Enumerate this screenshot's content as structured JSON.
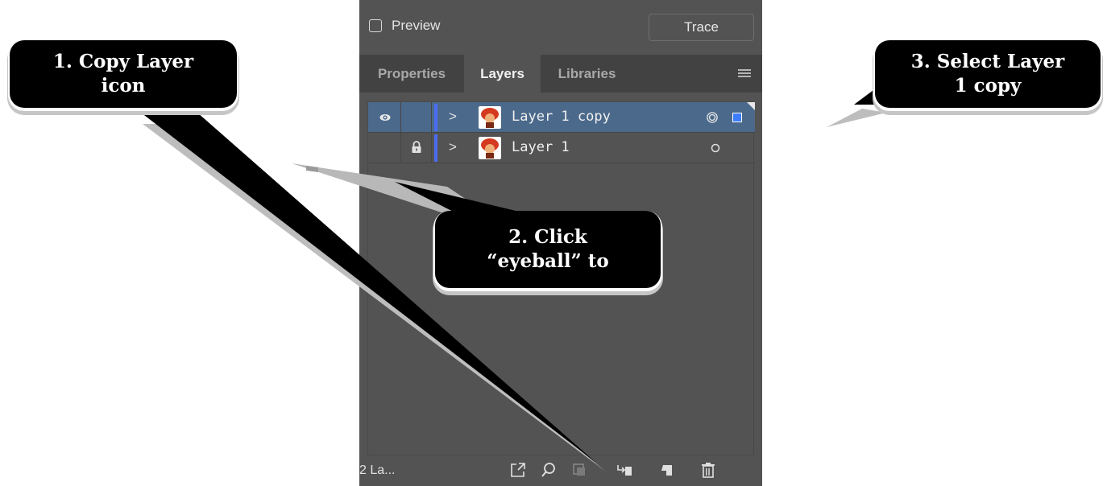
{
  "topbar": {
    "preview_label": "Preview",
    "preview_checked": false,
    "trace_label": "Trace"
  },
  "tabs": [
    {
      "label": "Properties",
      "active": false
    },
    {
      "label": "Layers",
      "active": true
    },
    {
      "label": "Libraries",
      "active": false
    }
  ],
  "layers": [
    {
      "name": "Layer 1 copy",
      "visible": true,
      "locked": false,
      "selected": true
    },
    {
      "name": "Layer 1",
      "visible": false,
      "locked": true,
      "selected": false
    }
  ],
  "footer": {
    "count_label": "2 La...",
    "icons": [
      "export-icon",
      "locate-object-icon",
      "make-clip-mask-icon",
      "move-to-layer-icon",
      "new-layer-icon",
      "delete-icon"
    ]
  },
  "callouts": {
    "one": "1. Copy Layer\nicon",
    "two": "2. Click\n“eyeball” to",
    "three": "3. Select Layer\n1 copy"
  },
  "colors": {
    "panel_bg": "#535353",
    "tab_bar_bg": "#424242",
    "selected_row": "#4b6a8b",
    "layer_color": "#4b6cf2",
    "callout_bg": "#000000"
  }
}
